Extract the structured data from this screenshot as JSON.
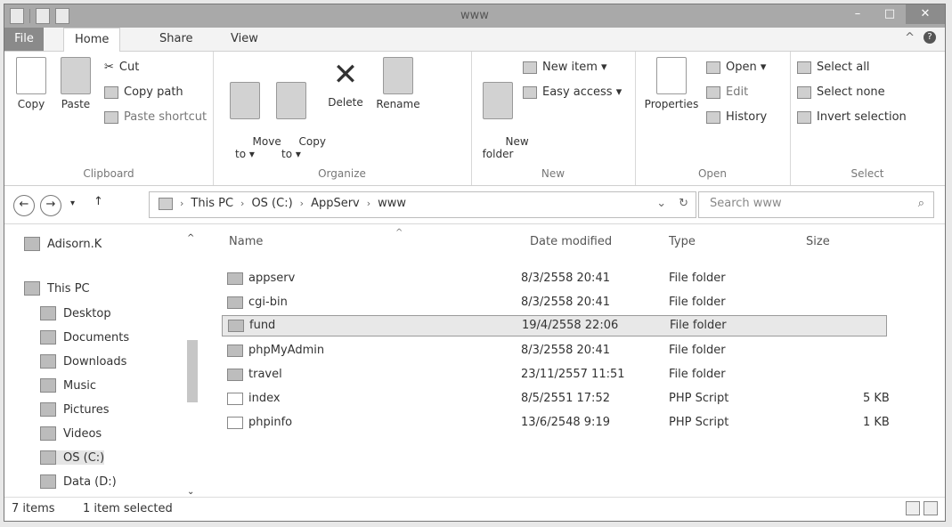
{
  "window": {
    "title": "www"
  },
  "tabs": {
    "file": "File",
    "home": "Home",
    "share": "Share",
    "view": "View"
  },
  "ribbon": {
    "clipboard": {
      "label": "Clipboard",
      "copy": "Copy",
      "paste": "Paste",
      "cut": "Cut",
      "copy_path": "Copy path",
      "paste_shortcut": "Paste shortcut"
    },
    "organize": {
      "label": "Organize",
      "move_to": "Move\nto ▾",
      "copy_to": "Copy\nto ▾",
      "delete": "Delete",
      "rename": "Rename"
    },
    "new": {
      "label": "New",
      "new_folder": "New\nfolder",
      "new_item": "New item ▾",
      "easy_access": "Easy access ▾"
    },
    "open": {
      "label": "Open",
      "properties": "Properties",
      "open": "Open ▾",
      "edit": "Edit",
      "history": "History"
    },
    "select": {
      "label": "Select",
      "select_all": "Select all",
      "select_none": "Select none",
      "invert_selection": "Invert selection"
    }
  },
  "address": {
    "crumbs": [
      "This PC",
      "OS (C:)",
      "AppServ",
      "www"
    ],
    "search_placeholder": "Search www"
  },
  "sidebar": {
    "user": "Adisorn.K",
    "this_pc": "This PC",
    "items": [
      "Desktop",
      "Documents",
      "Downloads",
      "Music",
      "Pictures",
      "Videos",
      "OS (C:)",
      "Data (D:)"
    ]
  },
  "columns": {
    "name": "Name",
    "date": "Date modified",
    "type": "Type",
    "size": "Size"
  },
  "files": [
    {
      "name": "appserv",
      "date": "8/3/2558 20:41",
      "type": "File folder",
      "size": "",
      "icon": "folder-icon"
    },
    {
      "name": "cgi-bin",
      "date": "8/3/2558 20:41",
      "type": "File folder",
      "size": "",
      "icon": "folder-icon"
    },
    {
      "name": "fund",
      "date": "19/4/2558 22:06",
      "type": "File folder",
      "size": "",
      "icon": "folder-icon",
      "selected": true
    },
    {
      "name": "phpMyAdmin",
      "date": "8/3/2558 20:41",
      "type": "File folder",
      "size": "",
      "icon": "folder-icon"
    },
    {
      "name": "travel",
      "date": "23/11/2557 11:51",
      "type": "File folder",
      "size": "",
      "icon": "folder-icon"
    },
    {
      "name": "index",
      "date": "8/5/2551 17:52",
      "type": "PHP Script",
      "size": "5 KB",
      "icon": "php-file-icon"
    },
    {
      "name": "phpinfo",
      "date": "13/6/2548 9:19",
      "type": "PHP Script",
      "size": "1 KB",
      "icon": "php-file-icon"
    }
  ],
  "status": {
    "count": "7 items",
    "selected": "1 item selected"
  }
}
